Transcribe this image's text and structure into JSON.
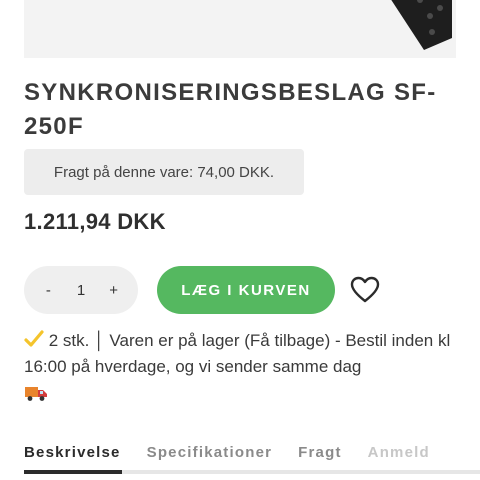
{
  "product": {
    "title": "SYNKRONISERINGSBESLAG SF-250F",
    "shipping_note": "Fragt på denne vare: 74,00 DKK.",
    "price": "1.211,94 DKK"
  },
  "purchase": {
    "qty_minus": "-",
    "qty_value": "1",
    "qty_plus": "+",
    "add_to_cart_label": "LÆG I KURVEN"
  },
  "stock": {
    "text": "2 stk. │ Varen er på lager (Få tilbage) - Bestil inden kl 16:00 på hverdage, og vi sender samme dag"
  },
  "tabs": [
    {
      "label": "Beskrivelse"
    },
    {
      "label": "Specifikationer"
    },
    {
      "label": "Fragt"
    },
    {
      "label": "Anmeld"
    }
  ],
  "icons": {
    "wishlist": "heart-outline-icon",
    "stock_check": "check-icon",
    "delivery": "truck-icon"
  },
  "colors": {
    "accent": "#55b860",
    "check": "#f4c42c",
    "truck": "#e8842c"
  }
}
